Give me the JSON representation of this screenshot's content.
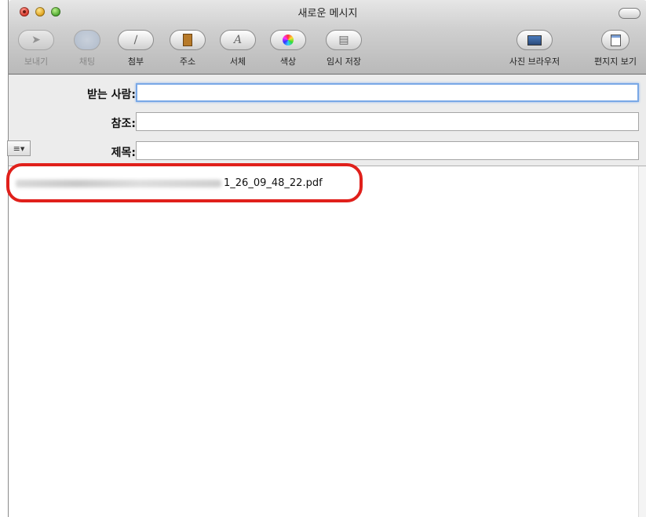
{
  "window": {
    "title": "새로운 메시지"
  },
  "toolbar": {
    "items": [
      {
        "label": "보내기",
        "icon": "send-icon",
        "glyph": "➤",
        "enabled": false
      },
      {
        "label": "채팅",
        "icon": "chat-icon",
        "glyph": "💬",
        "enabled": false
      },
      {
        "label": "첨부",
        "icon": "paperclip-icon",
        "glyph": "📎",
        "enabled": true
      },
      {
        "label": "주소",
        "icon": "address-book-icon",
        "glyph": "▣",
        "enabled": true
      },
      {
        "label": "서체",
        "icon": "font-icon",
        "glyph": "A",
        "enabled": true
      },
      {
        "label": "색상",
        "icon": "color-wheel-icon",
        "glyph": "●",
        "enabled": true
      },
      {
        "label": "임시 저장",
        "icon": "draft-icon",
        "glyph": "▤",
        "enabled": true
      },
      {
        "label": "사진 브라우저",
        "icon": "photo-browser-icon",
        "glyph": "▭",
        "enabled": true
      },
      {
        "label": "편지지 보기",
        "icon": "stationery-icon",
        "glyph": "▦",
        "enabled": true
      }
    ]
  },
  "fields": {
    "to_label": "받는 사람:",
    "to_value": "",
    "cc_label": "참조:",
    "cc_value": "",
    "subject_label": "제목:",
    "subject_value": "",
    "format_menu": "≡▾"
  },
  "body": {
    "attachment_filename_visible": "1_26_09_48_22.pdf"
  },
  "colors": {
    "highlight": "#e0201b",
    "focus_ring": "#79a8e6"
  }
}
